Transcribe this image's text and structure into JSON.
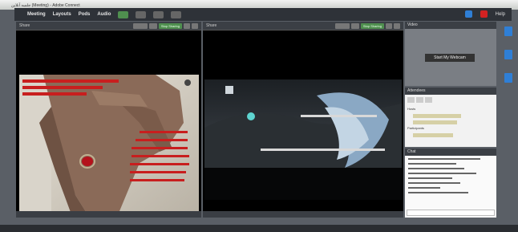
{
  "window": {
    "title": "جلسه آنلاین (Meeting) - Adobe Connect"
  },
  "menu": {
    "items": [
      "Meeting",
      "Layouts",
      "Pods",
      "Audio"
    ],
    "help_label": "Help"
  },
  "pods": {
    "share_left": {
      "title": "Share",
      "buttons": [
        "Stop Sharing"
      ]
    },
    "share_center": {
      "title": "Share",
      "buttons": [
        "Stop Sharing"
      ]
    },
    "video": {
      "title": "Video",
      "start_label": "Start My Webcam"
    },
    "attendees": {
      "title": "Attendees",
      "section_hosts": "Hosts",
      "section_participants": "Participants"
    },
    "chat": {
      "title": "Chat"
    }
  },
  "colors": {
    "accent_green": "#4f8f4f",
    "accent_blue": "#2f7fd6",
    "record_red": "#d22222"
  }
}
